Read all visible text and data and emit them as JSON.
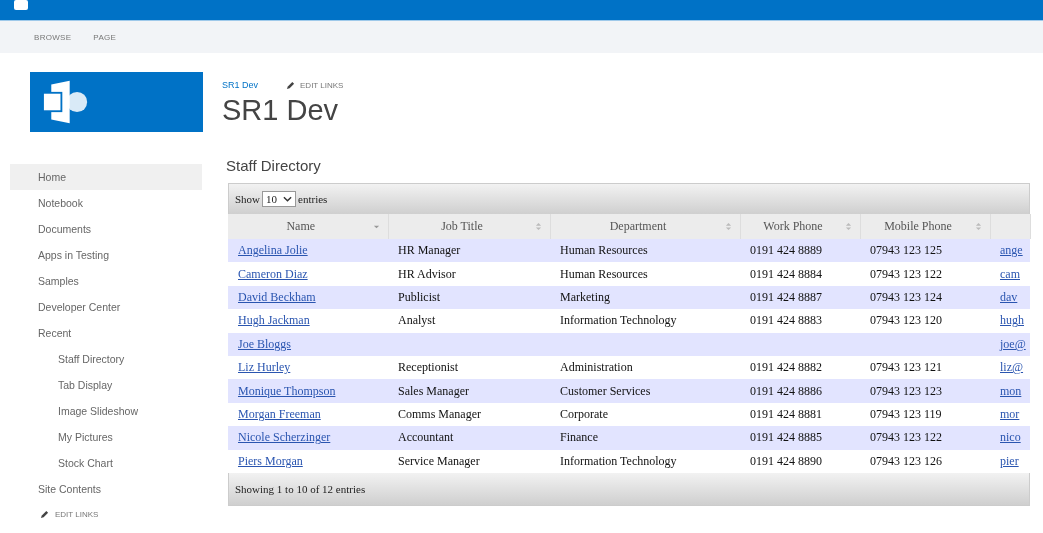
{
  "ribbon": {
    "tabs": [
      {
        "label": "BROWSE",
        "selected": false
      },
      {
        "label": "PAGE",
        "selected": false
      }
    ]
  },
  "header": {
    "breadcrumb": "SR1 Dev",
    "edit_links": "EDIT LINKS",
    "title": "SR1 Dev"
  },
  "sidebar": {
    "items": [
      {
        "label": "Home",
        "selected": true
      },
      {
        "label": "Notebook",
        "selected": false
      },
      {
        "label": "Documents",
        "selected": false
      },
      {
        "label": "Apps in Testing",
        "selected": false
      },
      {
        "label": "Samples",
        "selected": false
      },
      {
        "label": "Developer Center",
        "selected": false
      },
      {
        "label": "Recent",
        "selected": false,
        "children": [
          {
            "label": "Staff Directory",
            "selected": false
          },
          {
            "label": "Tab Display",
            "selected": false
          },
          {
            "label": "Image Slideshow",
            "selected": false
          },
          {
            "label": "My Pictures",
            "selected": false
          },
          {
            "label": "Stock Chart",
            "selected": false
          }
        ]
      },
      {
        "label": "Site Contents",
        "selected": false
      }
    ],
    "edit_links": "EDIT LINKS"
  },
  "section_title": "Staff Directory",
  "table": {
    "length_prefix": "Show",
    "length_value": "10",
    "length_suffix": "entries",
    "columns": [
      {
        "label": "Name",
        "sorted": true
      },
      {
        "label": "Job Title",
        "sorted": false
      },
      {
        "label": "Department",
        "sorted": false
      },
      {
        "label": "Work Phone",
        "sorted": false
      },
      {
        "label": "Mobile Phone",
        "sorted": false
      },
      {}
    ],
    "rows": [
      [
        "Angelina Jolie",
        "HR Manager",
        "Human Resources",
        "0191 424 8889",
        "07943 123 125",
        "ange"
      ],
      [
        "Cameron Diaz",
        "HR Advisor",
        "Human Resources",
        "0191 424 8884",
        "07943 123 122",
        "cam"
      ],
      [
        "David Beckham",
        "Publicist",
        "Marketing",
        "0191 424 8887",
        "07943 123 124",
        "dav"
      ],
      [
        "Hugh Jackman",
        "Analyst",
        "Information Technology",
        "0191 424 8883",
        "07943 123 120",
        "hugh"
      ],
      [
        "Joe Bloggs",
        "",
        "",
        "",
        "",
        "joe@"
      ],
      [
        "Liz Hurley",
        "Receptionist",
        "Administration",
        "0191 424 8882",
        "07943 123 121",
        "liz@"
      ],
      [
        "Monique Thompson",
        "Sales Manager",
        "Customer Services",
        "0191 424 8886",
        "07943 123 123",
        "mon"
      ],
      [
        "Morgan Freeman",
        "Comms Manager",
        "Corporate",
        "0191 424 8881",
        "07943 123 119",
        "mor"
      ],
      [
        "Nicole Scherzinger",
        "Accountant",
        "Finance",
        "0191 424 8885",
        "07943 123 122",
        "nico"
      ],
      [
        "Piers Morgan",
        "Service Manager",
        "Information Technology",
        "0191 424 8890",
        "07943 123 126",
        "pier"
      ]
    ],
    "info": "Showing 1 to 10 of 12 entries"
  }
}
